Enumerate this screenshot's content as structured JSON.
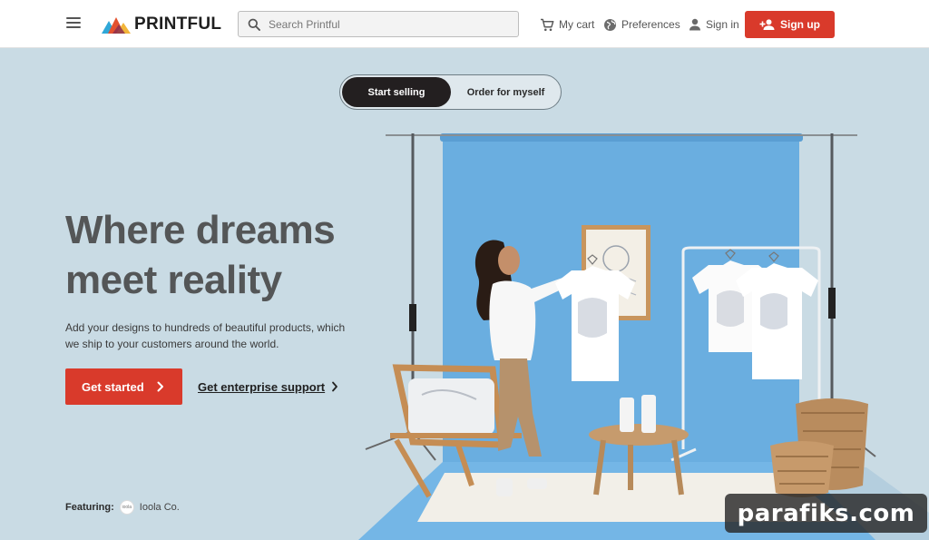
{
  "header": {
    "logo_text": "PRINTFUL",
    "search_placeholder": "Search Printful",
    "cart_label": "My cart",
    "preferences_label": "Preferences",
    "signin_label": "Sign in",
    "signup_label": "Sign up"
  },
  "toggle": {
    "active_label": "Start selling",
    "inactive_label": "Order for myself"
  },
  "hero": {
    "headline": "Where dreams meet reality",
    "subtext": "Add your designs to hundreds of beautiful products, which we ship to your customers around the world.",
    "cta_label": "Get started",
    "enterprise_label": "Get enterprise support"
  },
  "featuring": {
    "label": "Featuring:",
    "brand_logo_text": "ioola",
    "brand_name": "Ioola Co."
  },
  "watermark": "parafiks.com",
  "colors": {
    "brand_red": "#d93a2b",
    "hero_bg": "#c9dbe4",
    "backdrop_blue": "#6aaee0"
  }
}
